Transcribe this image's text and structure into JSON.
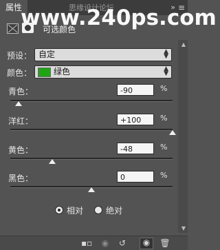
{
  "tab": {
    "label": "属性"
  },
  "tabbar_title": "思缘设计论坛",
  "watermark": "www.240ps.com",
  "adjustment": {
    "title": "可选颜色"
  },
  "preset": {
    "label": "预设：",
    "value": "自定"
  },
  "colors": {
    "label": "颜色：",
    "value": "绿色",
    "swatch": "#1fa514"
  },
  "sliders": [
    {
      "label": "青色：",
      "value": "-90",
      "unit": "%",
      "level": -90
    },
    {
      "label": "洋红：",
      "value": "+100",
      "unit": "%",
      "level": 100
    },
    {
      "label": "黄色：",
      "value": "-48",
      "unit": "%",
      "level": -48
    },
    {
      "label": "黑色：",
      "value": "0",
      "unit": "%",
      "level": 0
    }
  ],
  "method": {
    "relative": "相对",
    "absolute": "绝对",
    "selected": "relative"
  },
  "icons": [
    "adjustment-icon",
    "mask-icon",
    "clip-layer-icon",
    "view-previous-icon",
    "reset-icon",
    "visibility-icon",
    "delete-icon",
    "panel-menu-icon"
  ]
}
